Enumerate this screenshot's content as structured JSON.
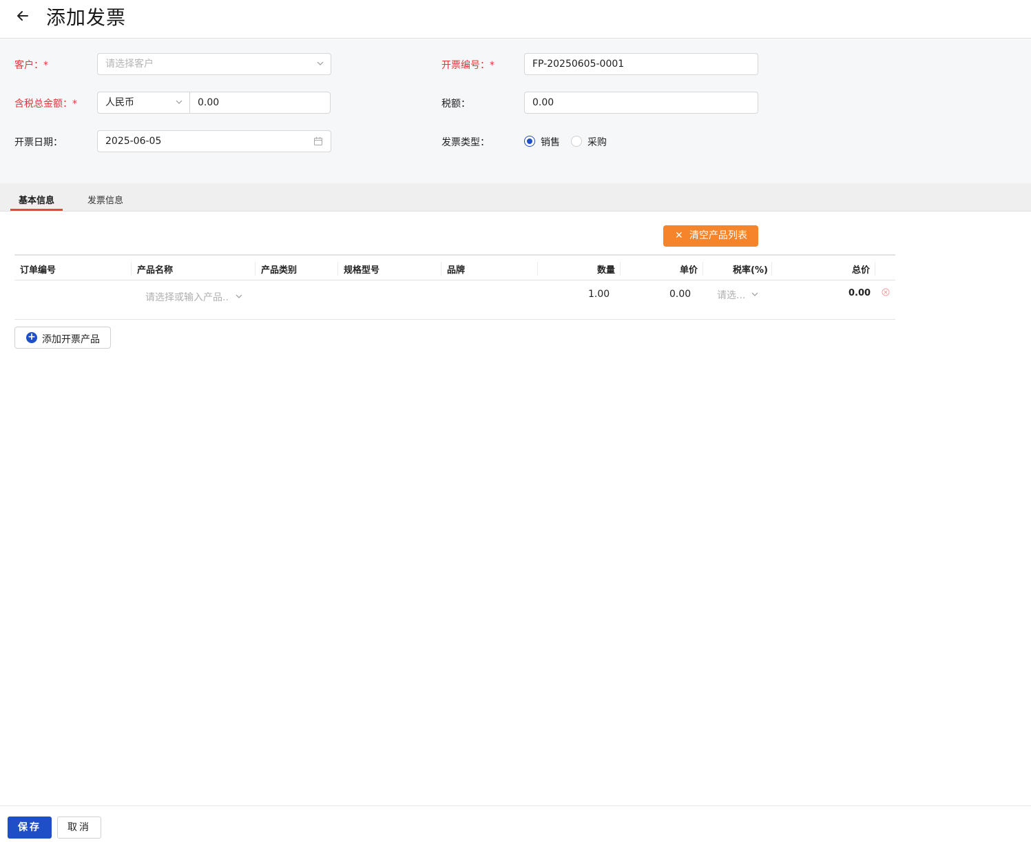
{
  "header": {
    "title": "添加发票",
    "back_icon": "arrow-left-icon"
  },
  "form": {
    "customer": {
      "label": "客户：*",
      "placeholder": "请选择客户"
    },
    "invoice_no": {
      "label": "开票编号：*",
      "value": "FP-20250605-0001"
    },
    "total_amount": {
      "label": "含税总金额：*",
      "currency": "人民币",
      "value": "0.00"
    },
    "tax": {
      "label": "税额：",
      "value": "0.00"
    },
    "invoice_date": {
      "label": "开票日期：",
      "value": "2025-06-05"
    },
    "invoice_type": {
      "label": "发票类型：",
      "options": [
        "销售",
        "采购"
      ],
      "selected": "销售"
    }
  },
  "tabs": {
    "basic": "基本信息",
    "invoice": "发票信息",
    "active": "基本信息"
  },
  "toolbar": {
    "clear_label": "清空产品列表"
  },
  "table": {
    "headers": {
      "order_no": "订单编号",
      "product_name": "产品名称",
      "category": "产品类别",
      "spec": "规格型号",
      "brand": "品牌",
      "qty": "数量",
      "unit_price": "单价",
      "tax_rate": "税率(%)",
      "total": "总价"
    },
    "rows": [
      {
        "order_no": "",
        "product_placeholder": "请选择或输入产品..",
        "qty": "1.00",
        "unit_price": "0.00",
        "tax_placeholder": "请选...",
        "total": "0.00"
      }
    ]
  },
  "add_product_label": "添加开票产品",
  "footer": {
    "save_label": "保存",
    "cancel_label": "取消"
  },
  "colors": {
    "primary": "#1f4fc7",
    "orange": "#f5842a",
    "required": "#e0383a",
    "tab_accent": "#e94735"
  }
}
